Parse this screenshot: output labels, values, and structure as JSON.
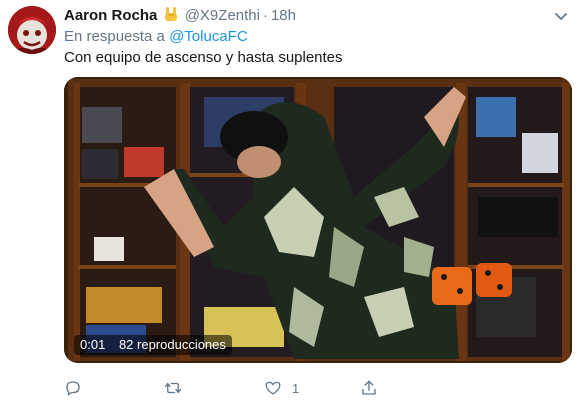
{
  "tweet": {
    "author": {
      "display_name": "Aaron Rocha",
      "badge_emoji": "🤘",
      "handle": "@X9Zenthi"
    },
    "separator": "·",
    "timestamp": "18h",
    "reply_prefix": "En respuesta a",
    "reply_mention": "@TolucaFC",
    "text": "Con equipo de ascenso y hasta suplentes",
    "media": {
      "type": "video",
      "time": "0:01",
      "views": "82 reproducciones"
    },
    "actions": {
      "reply_icon": "reply-icon",
      "retweet_icon": "retweet-icon",
      "like_icon": "heart-icon",
      "like_count": "1",
      "share_icon": "share-icon"
    }
  },
  "colors": {
    "accent": "#1b95e0",
    "secondary_text": "#657786",
    "primary_text": "#14171a"
  }
}
